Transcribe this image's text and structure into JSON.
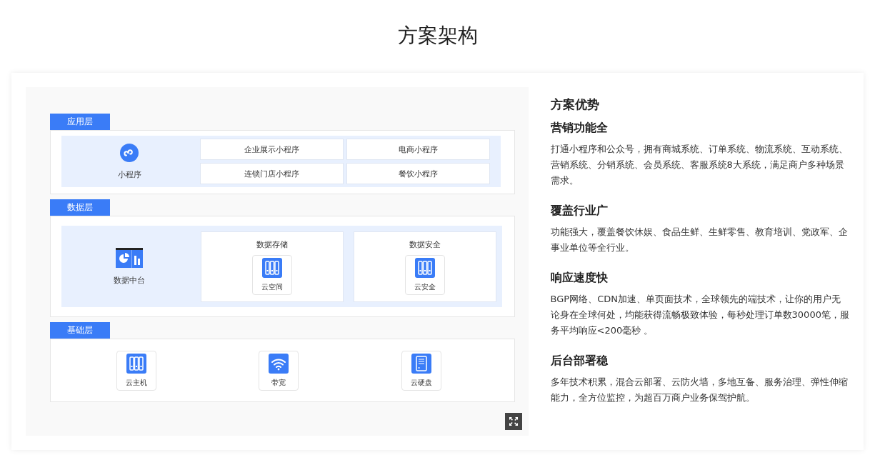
{
  "title": "方案架构",
  "diagram": {
    "layers": [
      {
        "label": "应用层",
        "kind": "grid",
        "main": {
          "label": "小程序",
          "kind": "miniprogram"
        },
        "items": [
          "企业展示小程序",
          "电商小程序",
          "连锁门店小程序",
          "餐饮小程序"
        ]
      },
      {
        "label": "数据层",
        "kind": "groups",
        "main": {
          "label": "数据中台",
          "kind": "dashboard"
        },
        "groups": [
          {
            "title": "数据存储",
            "tiles": [
              {
                "label": "云空间",
                "kind": "server"
              }
            ]
          },
          {
            "title": "数据安全",
            "tiles": [
              {
                "label": "云安全",
                "kind": "server"
              }
            ]
          }
        ]
      },
      {
        "label": "基础层",
        "kind": "tiles",
        "tiles": [
          {
            "label": "云主机",
            "kind": "server"
          },
          {
            "label": "带宽",
            "kind": "wifi"
          },
          {
            "label": "云硬盘",
            "kind": "disk"
          }
        ]
      }
    ]
  },
  "advantages": {
    "heading": "方案优势",
    "items": [
      {
        "title": "营销功能全",
        "text": "打通小程序和公众号，拥有商城系统、订单系统、物流系统、互动系统、营销系统、分销系统、会员系统、客服系统8大系统，满足商户多种场景需求。"
      },
      {
        "title": "覆盖行业广",
        "text": "功能强大，覆盖餐饮休娱、食品生鲜、生鲜零售、教育培训、党政军、企事业单位等全行业。"
      },
      {
        "title": "响应速度快",
        "text": "BGP网络、CDN加速、单页面技术，全球领先的端技术，让你的用户无论身在全球何处，均能获得流畅极致体验，每秒处理订单数30000笔，服务平均响应<200毫秒 。"
      },
      {
        "title": "后台部署稳",
        "text": "多年技术积累，混合云部署、云防火墙，多地互备、服务治理、弹性伸缩能力，全方位监控，为超百万商户业务保驾护航。"
      }
    ]
  }
}
